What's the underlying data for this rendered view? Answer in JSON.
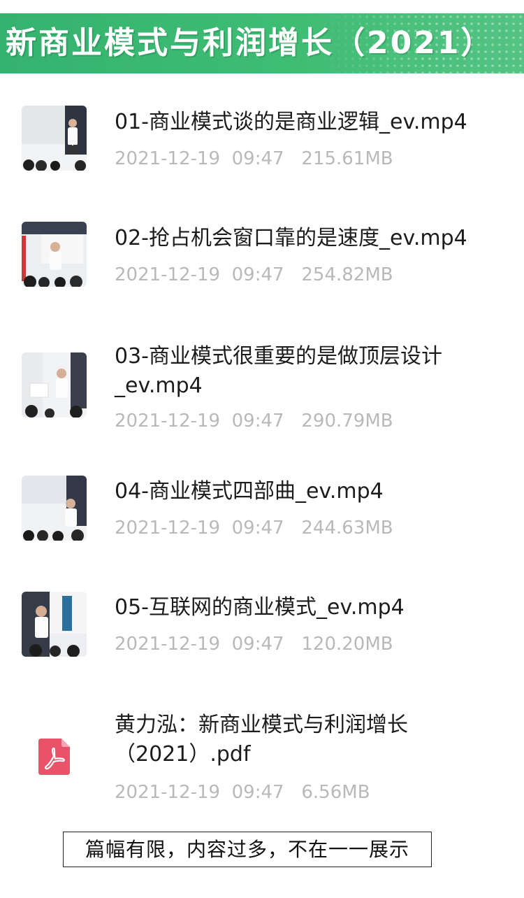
{
  "header": {
    "title": "新商业模式与利润增长（2021）"
  },
  "files": [
    {
      "name": "01-商业模式谈的是商业逻辑_ev.mp4",
      "date": "2021-12-19",
      "time": "09:47",
      "size": "215.61MB",
      "icon": "video-thumbnail"
    },
    {
      "name": "02-抢占机会窗口靠的是速度_ev.mp4",
      "date": "2021-12-19",
      "time": "09:47",
      "size": "254.82MB",
      "icon": "video-thumbnail"
    },
    {
      "name": "03-商业模式很重要的是做顶层设计_ev.mp4",
      "date": "2021-12-19",
      "time": "09:47",
      "size": "290.79MB",
      "icon": "video-thumbnail"
    },
    {
      "name": "04-商业模式四部曲_ev.mp4",
      "date": "2021-12-19",
      "time": "09:47",
      "size": "244.63MB",
      "icon": "video-thumbnail"
    },
    {
      "name": "05-互联网的商业模式_ev.mp4",
      "date": "2021-12-19",
      "time": "09:47",
      "size": "120.20MB",
      "icon": "video-thumbnail"
    },
    {
      "name": "黄力泓：新商业模式与利润增长（2021）.pdf",
      "date": "2021-12-19",
      "time": "09:47",
      "size": "6.56MB",
      "icon": "pdf-icon"
    }
  ],
  "footer": {
    "notice": "篇幅有限，内容过多，不在一一展示"
  },
  "colors": {
    "banner": "#3fbc74",
    "pdf": "#e9536a",
    "meta_text": "#b9b9b9"
  }
}
